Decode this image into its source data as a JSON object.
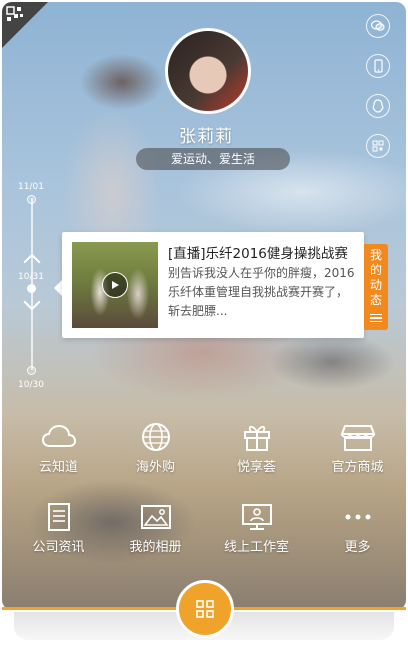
{
  "profile": {
    "name": "张莉莉",
    "tagline": "爱运动、爱生活"
  },
  "side_icons": [
    "wechat-icon",
    "phone-icon",
    "qq-icon",
    "qrcode-icon"
  ],
  "timeline": {
    "top_date": "11/01",
    "current_date": "10/31",
    "bottom_date": "10/30"
  },
  "feed_card": {
    "title": "[直播]乐纤2016健身操挑战赛",
    "description": "别告诉我没人在乎你的胖瘦，2016乐纤体重管理自我挑战赛开赛了，斩去肥膘..."
  },
  "my_feed_tab": {
    "label": "我的动态"
  },
  "menu": [
    {
      "label": "云知道",
      "icon": "cloud-icon"
    },
    {
      "label": "海外购",
      "icon": "globe-icon"
    },
    {
      "label": "悦享荟",
      "icon": "gift-icon"
    },
    {
      "label": "官方商城",
      "icon": "store-icon"
    },
    {
      "label": "公司资讯",
      "icon": "document-icon"
    },
    {
      "label": "我的相册",
      "icon": "photo-album-icon"
    },
    {
      "label": "线上工作室",
      "icon": "studio-icon"
    },
    {
      "label": "更多",
      "icon": "more-icon"
    }
  ],
  "colors": {
    "accent": "#f0a32b",
    "tab_orange": "#f08a1e"
  }
}
